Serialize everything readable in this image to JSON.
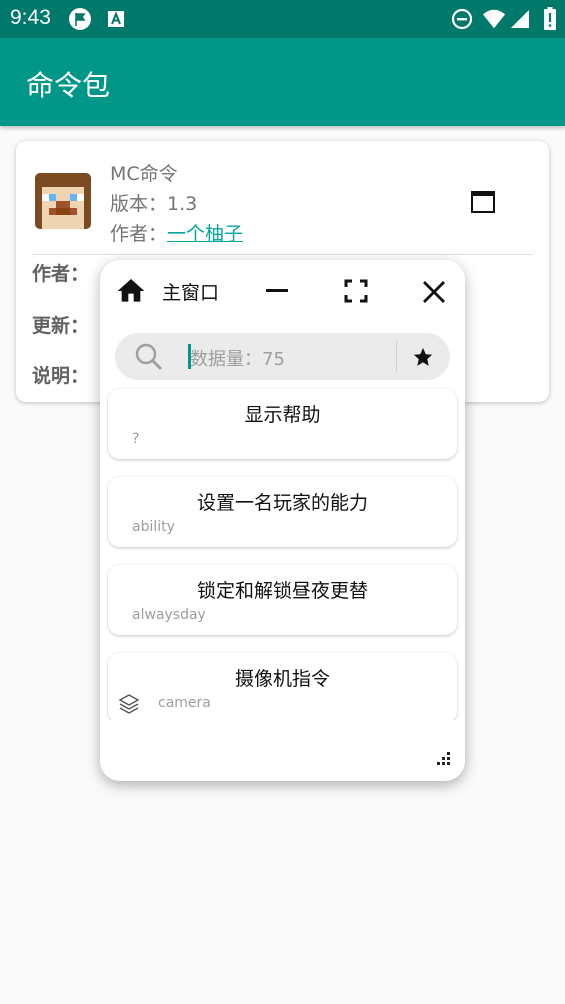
{
  "status": {
    "time": "9:43"
  },
  "appbar": {
    "title": "命令包"
  },
  "package": {
    "name": "MC命令",
    "version_label": "版本：",
    "version": "1.3",
    "author_label": "作者：",
    "author": "一个柚子",
    "rows": [
      "作者：",
      "更新：",
      "说明："
    ]
  },
  "floating_window": {
    "title": "主窗口",
    "search": {
      "placeholder": "数据量：75"
    },
    "items": [
      {
        "name": "显示帮助",
        "command": "?"
      },
      {
        "name": "设置一名玩家的能力",
        "command": "ability"
      },
      {
        "name": "锁定和解锁昼夜更替",
        "command": "alwaysday"
      },
      {
        "name": "摄像机指令",
        "command": "camera"
      }
    ]
  },
  "colors": {
    "primary": "#009688",
    "primary_dark": "#00796b",
    "link": "#00a79d"
  },
  "icons": [
    "flag-icon",
    "accessibility-icon",
    "dnd-icon",
    "wifi-icon",
    "signal-icon",
    "battery-icon",
    "home-icon",
    "minimize-icon",
    "fullscreen-icon",
    "close-icon",
    "search-icon",
    "star-icon",
    "layers-icon",
    "resize-handle-icon",
    "window-icon"
  ]
}
